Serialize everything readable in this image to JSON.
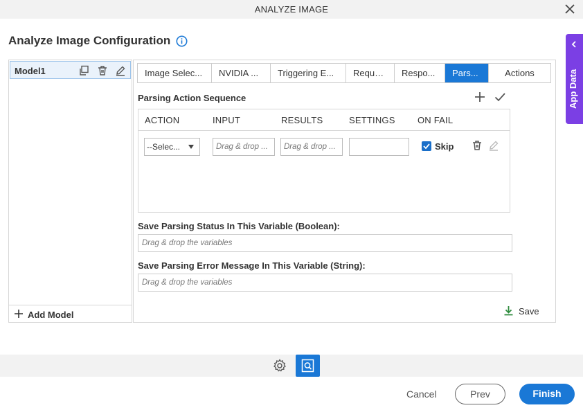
{
  "window": {
    "title": "ANALYZE IMAGE"
  },
  "page": {
    "heading": "Analyze Image Configuration"
  },
  "app_data": {
    "label": "App Data"
  },
  "models": {
    "items": [
      {
        "name": "Model1"
      }
    ],
    "add_label": "Add Model"
  },
  "tabs": [
    {
      "label": "Image Selec..."
    },
    {
      "label": "NVIDIA ..."
    },
    {
      "label": "Triggering E..."
    },
    {
      "label": "Reque..."
    },
    {
      "label": "Respo..."
    },
    {
      "label": "Pars...",
      "active": true
    },
    {
      "label": "Actions"
    }
  ],
  "parsing": {
    "title": "Parsing Action Sequence",
    "columns": [
      "ACTION",
      "INPUT",
      "RESULTS",
      "SETTINGS",
      "ON FAIL"
    ],
    "row": {
      "action_value": "--Selec...",
      "input_placeholder": "Drag & drop ...",
      "results_placeholder": "Drag & drop ...",
      "settings_value": "",
      "on_fail_checked": true,
      "on_fail_label": "Skip"
    }
  },
  "status_var": {
    "label": "Save Parsing Status In This Variable (Boolean):",
    "placeholder": "Drag & drop the variables"
  },
  "error_var": {
    "label": "Save Parsing Error Message In This Variable (String):",
    "placeholder": "Drag & drop the variables"
  },
  "save_label": "Save",
  "footer": {
    "cancel": "Cancel",
    "prev": "Prev",
    "finish": "Finish"
  },
  "colors": {
    "accent": "#1a78d6",
    "app_data": "#7b3fe4",
    "save_icon": "#2e8b3d"
  }
}
